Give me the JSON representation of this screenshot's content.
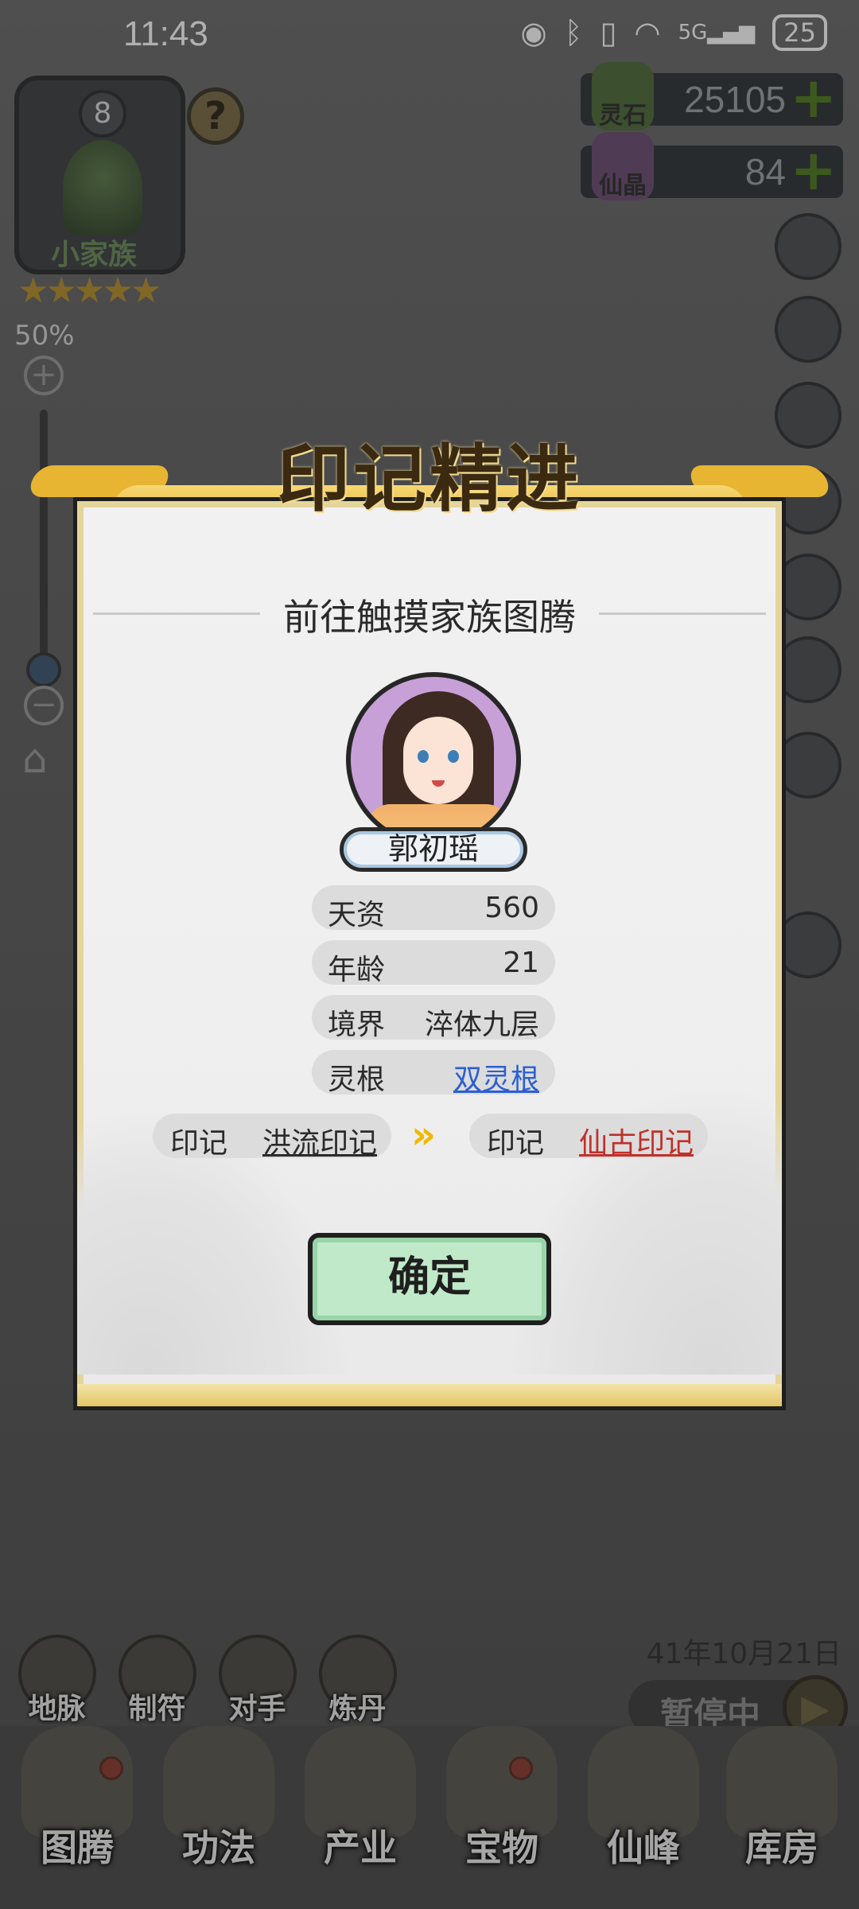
{
  "status_bar": {
    "time": "11:43",
    "battery": "25",
    "network": "5G"
  },
  "clan": {
    "level": "8",
    "name": "小家族",
    "stars": "★★★★★",
    "help": "?"
  },
  "zoom": {
    "percent": "50%",
    "plus": "+",
    "minus": "−",
    "level": 0.5
  },
  "resources": [
    {
      "label": "灵石",
      "value": "25105",
      "plus": "+"
    },
    {
      "label": "仙晶",
      "value": "84",
      "plus": "+"
    }
  ],
  "tools": [
    {
      "label": "地脉"
    },
    {
      "label": "制符"
    },
    {
      "label": "对手"
    },
    {
      "label": "炼丹"
    }
  ],
  "game_date": "41年10月21日",
  "pause_label": "暂停中",
  "bottom_nav": [
    {
      "label": "图腾"
    },
    {
      "label": "功法"
    },
    {
      "label": "产业"
    },
    {
      "label": "宝物"
    },
    {
      "label": "仙峰"
    },
    {
      "label": "库房"
    }
  ],
  "dialog": {
    "title": "印记精进",
    "subtitle": "前往触摸家族图腾",
    "character_name": "郭初瑶",
    "stats": [
      {
        "key": "天资",
        "value": "560"
      },
      {
        "key": "年龄",
        "value": "21"
      },
      {
        "key": "境界",
        "value": "淬体九层"
      },
      {
        "key": "灵根",
        "value": "双灵根"
      }
    ],
    "mark_from": {
      "key": "印记",
      "value": "洪流印记"
    },
    "mark_to": {
      "key": "印记",
      "value": "仙古印记"
    },
    "confirm_label": "确定"
  },
  "colors": {
    "link_blue": "#2b5fd0",
    "mark_from_color": "#2a2a2a",
    "mark_to_color": "#c0302a",
    "confirm_bg": "#bfe9c8",
    "title_gold": "#e9b83a"
  }
}
